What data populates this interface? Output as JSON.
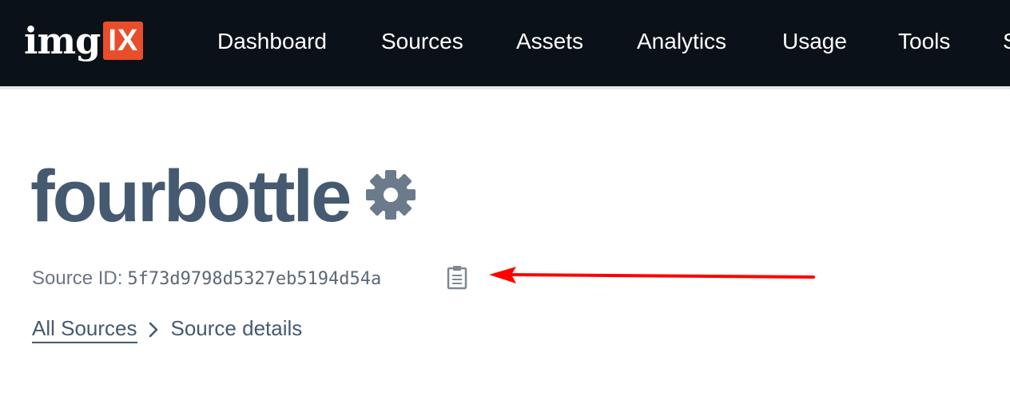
{
  "logo": {
    "text": "img",
    "box_text": "IX"
  },
  "nav": {
    "items": [
      {
        "label": "Dashboard"
      },
      {
        "label": "Sources"
      },
      {
        "label": "Assets"
      },
      {
        "label": "Analytics"
      },
      {
        "label": "Usage"
      },
      {
        "label": "Tools"
      },
      {
        "label": "S"
      }
    ]
  },
  "page": {
    "title": "fourbottle",
    "source_id_label": "Source ID:",
    "source_id_value": "5f73d9798d5327eb5194d54a"
  },
  "breadcrumb": {
    "link_label": "All Sources",
    "current_label": "Source details"
  },
  "icons": {
    "settings": "gear-icon",
    "copy": "clipboard-icon",
    "separator": "chevron-right-icon",
    "annotation": "arrow-left-icon"
  },
  "colors": {
    "topbar": "#0b1119",
    "logo_accent": "#e94e2a",
    "title": "#455a70",
    "gear": "#6b7b8c",
    "annotation_arrow": "#ff0000"
  }
}
